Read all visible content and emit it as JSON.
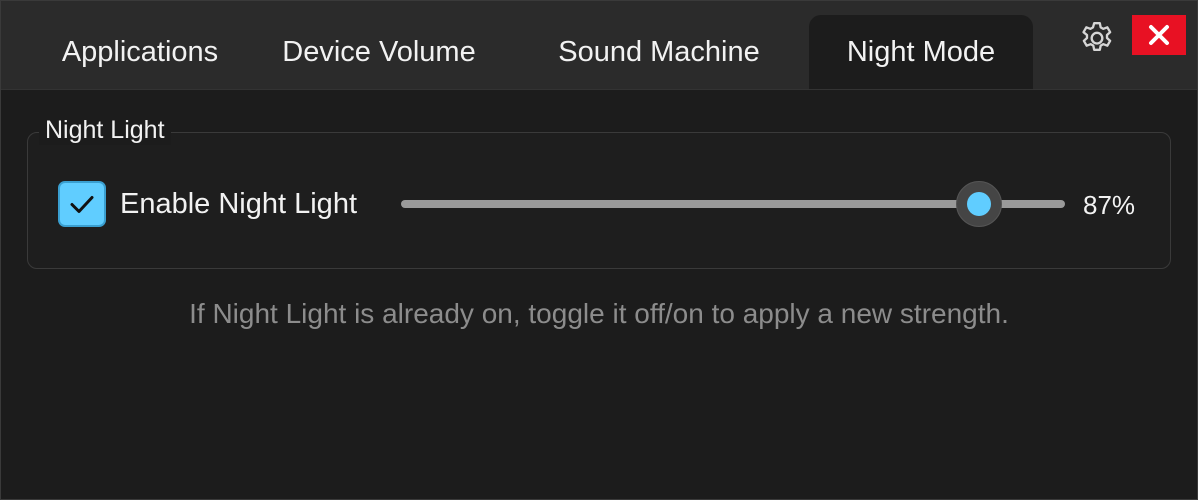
{
  "tabs": [
    {
      "label": "Applications",
      "active": false
    },
    {
      "label": "Device Volume",
      "active": false
    },
    {
      "label": "Sound Machine",
      "active": false
    },
    {
      "label": "Night Mode",
      "active": true
    }
  ],
  "toolbar": {
    "settings_icon": "gear-icon",
    "close_icon": "close-icon"
  },
  "night_light": {
    "group_title": "Night Light",
    "enable_label": "Enable Night Light",
    "enabled": true,
    "strength_percent": 87,
    "strength_text": "87%",
    "hint": "If Night Light is already on, toggle it off/on to apply a new strength."
  },
  "colors": {
    "accent": "#60cdff",
    "close_button": "#e81123",
    "background": "#1c1c1c",
    "tabbar": "#2b2b2b"
  }
}
